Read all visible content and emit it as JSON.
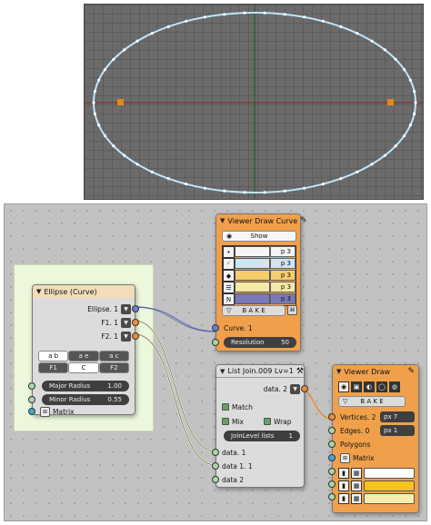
{
  "viewport": {
    "colors": {
      "background": "#6b6b6b",
      "ellipse": "#bfe6ff",
      "axis_x": "#8b2e2e",
      "axis_y": "#2b5a2b",
      "focus_point": "#e08a1b"
    }
  },
  "ellipse_node": {
    "title": "Ellipse (Curve)",
    "outputs": [
      {
        "label": "Ellipse. 1"
      },
      {
        "label": "F1. 1"
      },
      {
        "label": "F2. 1"
      }
    ],
    "mode_tabs": [
      "a b",
      "a e",
      "a c"
    ],
    "focus_tabs": [
      "F1",
      "C",
      "F2"
    ],
    "major_radius": {
      "label": "Major Radius",
      "value": "1.00"
    },
    "minor_radius": {
      "label": "Minor Radius",
      "value": "0.55"
    },
    "matrix_label": "Matrix"
  },
  "viewer_curve_node": {
    "title": "Viewer Draw Curve",
    "show_label": "Show",
    "rows": [
      {
        "icon": "vertex-icon",
        "value": "p 3",
        "color": "#f5f5f5"
      },
      {
        "icon": "curve-icon",
        "value": "p 3",
        "color": "#c6e7ff"
      },
      {
        "icon": "diamond-icon",
        "value": "p 3",
        "color": "#f5cd6a"
      },
      {
        "icon": "lines-icon",
        "value": "p 3",
        "color": "#f5e9a6"
      },
      {
        "icon": "n-icon",
        "value": "p 3",
        "color": "#7a78b8"
      }
    ],
    "bake_label": "B A K E",
    "input_label": "Curve. 1",
    "resolution": {
      "label": "Resolution",
      "value": "50"
    }
  },
  "list_join_node": {
    "title": "List Join.009 Lv=1",
    "output_label": "data. 2",
    "match_label": "Match",
    "mix_label": "Mix",
    "wrap_label": "Wrap",
    "joinlevel": {
      "label": "JoinLevel lists",
      "value": "1"
    },
    "inputs": [
      "data. 1",
      "data 1. 1",
      "data 2"
    ]
  },
  "viewer_draw_node": {
    "title": "Viewer Draw",
    "bake_label": "B A K E",
    "vertices": {
      "label": "Vertices. 2",
      "value": "px  7"
    },
    "edges": {
      "label": "Edges. 0",
      "value": "px  1"
    },
    "polygons_label": "Polygons",
    "matrix_label": "Matrix",
    "color_rows": [
      {
        "color": "#ffffff"
      },
      {
        "color": "#f5c518"
      },
      {
        "color": "#f5ecae"
      }
    ]
  }
}
